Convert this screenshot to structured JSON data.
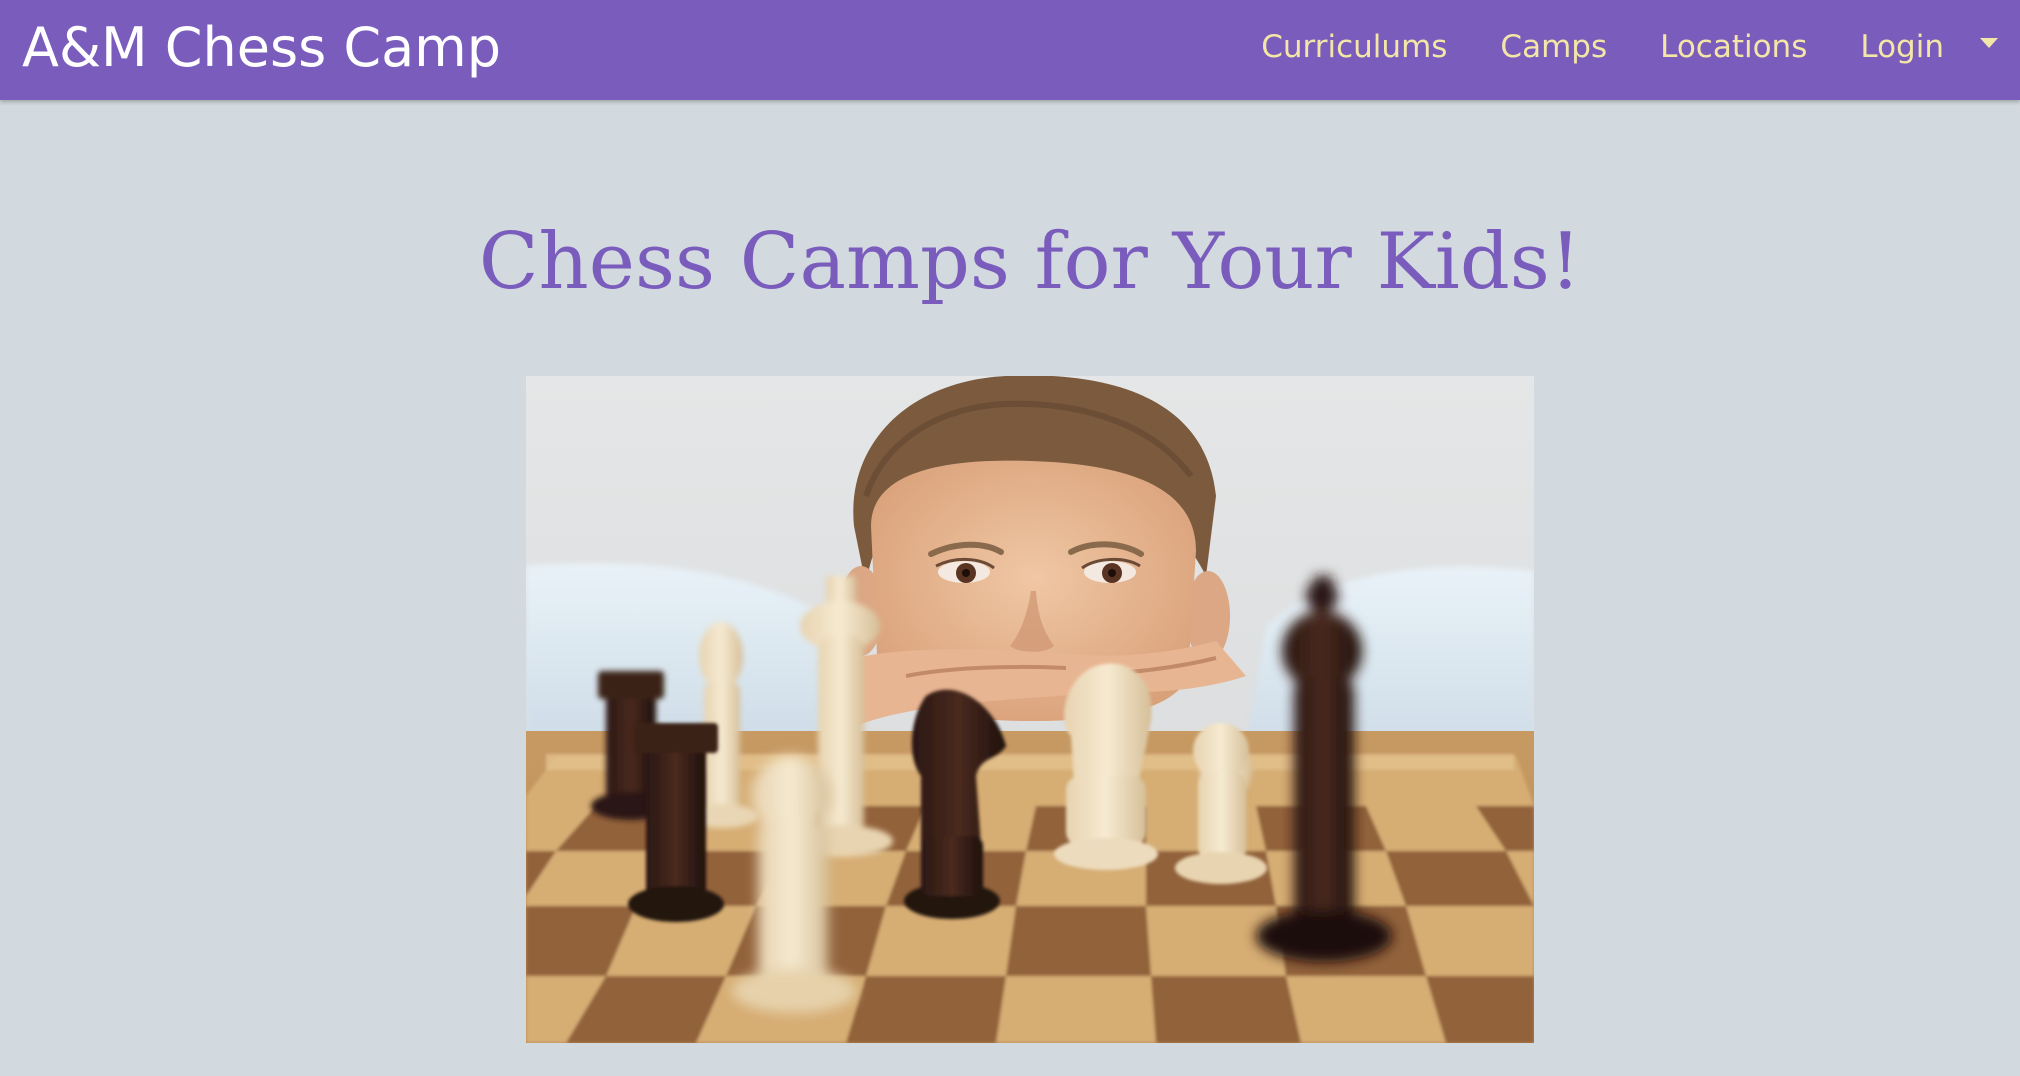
{
  "navbar": {
    "brand": "A&M Chess Camp",
    "links": [
      {
        "label": "Curriculums"
      },
      {
        "label": "Camps"
      },
      {
        "label": "Locations"
      },
      {
        "label": "Login"
      }
    ],
    "background_color": "#7a5cbd",
    "link_color": "#f3e6a6"
  },
  "main": {
    "heading": "Chess Camps for Your Kids!",
    "heading_color": "#7a5cbd",
    "page_background": "#d3dadf",
    "hero_image": {
      "alt": "boy-looking-at-chessboard-photo"
    }
  }
}
